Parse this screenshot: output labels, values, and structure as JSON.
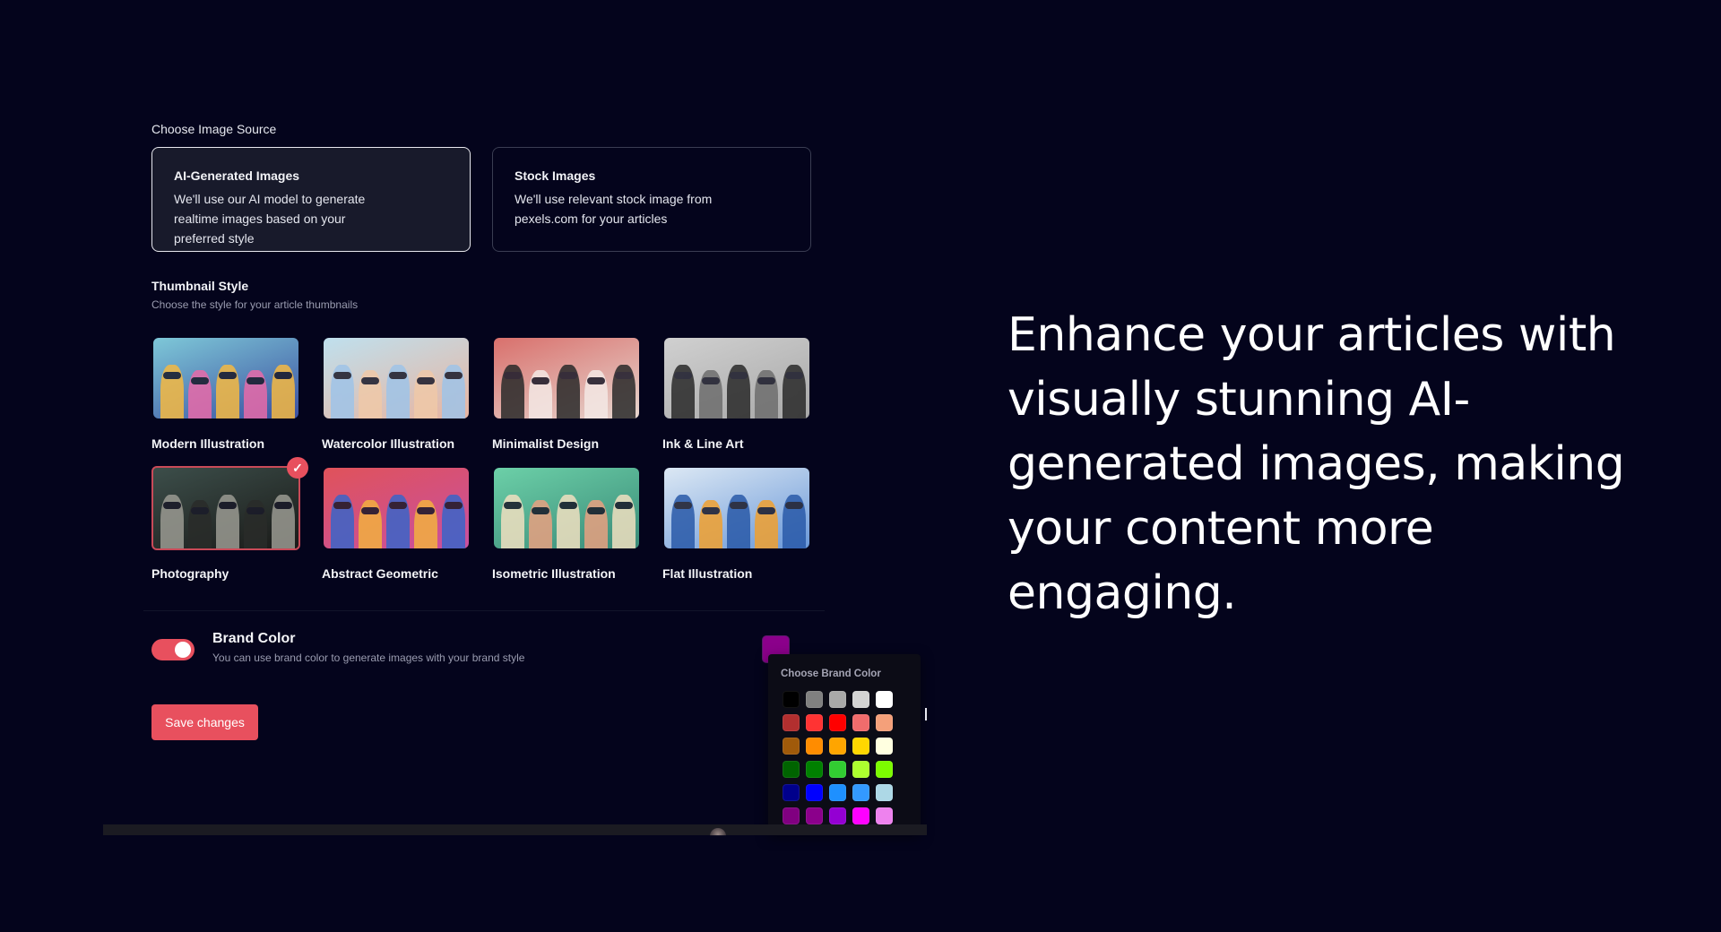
{
  "image_source": {
    "label": "Choose Image Source",
    "options": [
      {
        "title": "AI-Generated Images",
        "description": "We'll use our AI model to generate realtime images based on your preferred style",
        "selected": true
      },
      {
        "title": "Stock Images",
        "description": "We'll use relevant stock image from pexels.com for your articles",
        "selected": false
      }
    ]
  },
  "thumbnail_style": {
    "heading": "Thumbnail Style",
    "subheading": "Choose the style for your article thumbnails",
    "selected_icon": "check-icon",
    "check_glyph": "✓",
    "styles": [
      {
        "label": "Modern Illustration",
        "selected": false,
        "palette": [
          "#7ec8d8",
          "#e86aa8",
          "#f5b942",
          "#3b4fa0"
        ]
      },
      {
        "label": "Watercolor Illustration",
        "selected": false,
        "palette": [
          "#bfe0ee",
          "#f0c9a8",
          "#9fc4e8",
          "#e8b4a0"
        ]
      },
      {
        "label": "Minimalist Design",
        "selected": false,
        "palette": [
          "#d9706c",
          "#f4e8e4",
          "#2a2a2a",
          "#e6d6cf"
        ]
      },
      {
        "label": "Ink & Line Art",
        "selected": false,
        "palette": [
          "#d0d0d0",
          "#6e6e6e",
          "#2a2a2a",
          "#a8a8a8"
        ]
      },
      {
        "label": "Photography",
        "selected": true,
        "palette": [
          "#3c4e4a",
          "#2a2c2a",
          "#9a9a92",
          "#1a1a18"
        ]
      },
      {
        "label": "Abstract Geometric",
        "selected": false,
        "palette": [
          "#e0525a",
          "#f2b040",
          "#3a64c8",
          "#c850a0"
        ]
      },
      {
        "label": "Isometric Illustration",
        "selected": false,
        "palette": [
          "#6cd0a8",
          "#e8a080",
          "#f0e0c0",
          "#3a8a78"
        ]
      },
      {
        "label": "Flat Illustration",
        "selected": false,
        "palette": [
          "#dce8f4",
          "#f0a030",
          "#2a5aa8",
          "#6a98d8"
        ]
      }
    ]
  },
  "brand_color": {
    "title": "Brand Color",
    "description": "You can use brand color to generate images with your brand style",
    "enabled": true,
    "current_color": "#8b008b",
    "picker": {
      "title": "Choose Brand Color",
      "colors": [
        "#000000",
        "#808080",
        "#a9a9a9",
        "#d3d3d3",
        "#ffffff",
        "#b22f2f",
        "#ff3333",
        "#ff0000",
        "#f06c6c",
        "#f4a07a",
        "#a05a0a",
        "#ff8c00",
        "#ffa500",
        "#ffd700",
        "#ffffe0",
        "#006400",
        "#008000",
        "#32cd32",
        "#adff2f",
        "#7cfc00",
        "#00008b",
        "#0000ff",
        "#1e90ff",
        "#3399ff",
        "#add8e6",
        "#800080",
        "#8b008b",
        "#9400d3",
        "#ff00ff",
        "#ee82ee"
      ]
    }
  },
  "actions": {
    "save_label": "Save changes"
  },
  "accent_color": "#e8505e",
  "headline": "Enhance your articles with visually stunning AI-generated images, making your content more engaging."
}
